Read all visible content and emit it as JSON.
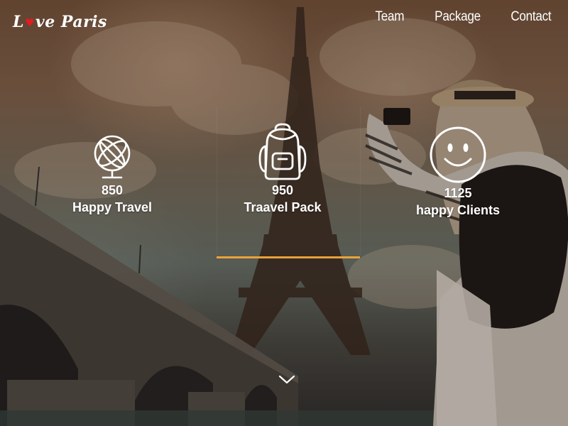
{
  "brand": {
    "logo_prefix": "L",
    "logo_heart": "♥",
    "logo_rest": "ve Paris",
    "heart_color": "#e31b23"
  },
  "nav": {
    "items": [
      {
        "label": "Team"
      },
      {
        "label": "Package"
      },
      {
        "label": "Contact"
      }
    ]
  },
  "stats": [
    {
      "icon": "globe-icon",
      "value": "850",
      "label": "Happy Travel"
    },
    {
      "icon": "backpack-icon",
      "value": "950",
      "label": "Traavel Pack"
    },
    {
      "icon": "smiley-icon",
      "value": "1125",
      "label": "happy Clients"
    }
  ],
  "colors": {
    "accent_line": "#e9a23b",
    "text": "#ffffff"
  },
  "scroll": {
    "icon": "chevron-down-icon"
  }
}
